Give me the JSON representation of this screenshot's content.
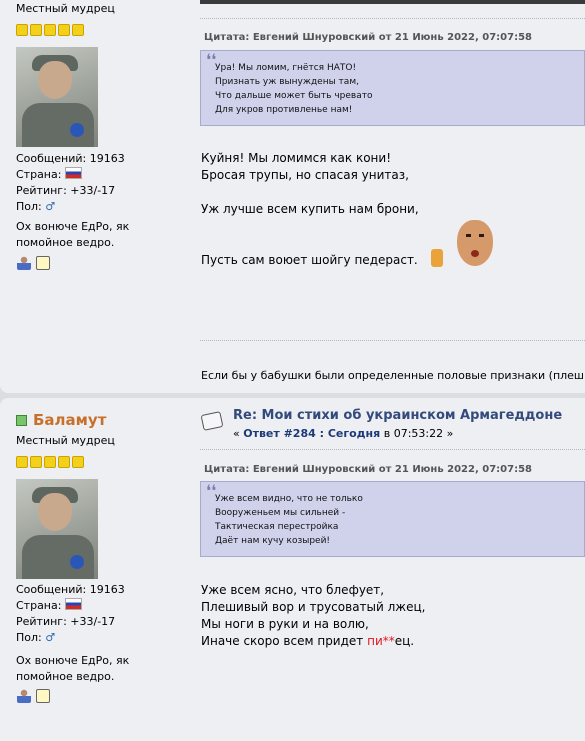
{
  "post1": {
    "rank": "Местный мудрец",
    "stats": {
      "messages_label": "Сообщений:",
      "messages_value": "19163",
      "country_label": "Страна:",
      "rating_label": "Рейтинг:",
      "rating_value": "+33/-17",
      "gender_label": "Пол:",
      "gender_value": "♂"
    },
    "signature": [
      "Ох вонюче ЕдРо, як",
      "помойное ведро."
    ],
    "quote": {
      "header": "Цитата: Евгений Шнуровский от 21 Июнь 2022, 07:07:58",
      "lines": [
        "Ура! Мы ломим, гнётся НАТО!",
        "Признать уж вынуждены там,",
        "Что дальше может быть чревато",
        "Для укров противленье нам!"
      ]
    },
    "text": [
      "Куйня! Мы ломимся как кони!",
      "Бросая трупы, но спасая унитаз,",
      "Уж лучше всем купить нам брони,",
      "Пусть сам воюет шойгу педераст."
    ],
    "signature_text": "Если бы у бабушки были определенные половые признаки (плешь) , т"
  },
  "post2": {
    "username": "Баламут",
    "rank": "Местный мудрец",
    "title": "Re: Мои стихи об украинском Армагеддоне",
    "subtitle_prefix": "« ",
    "reply_label": "Ответ #284 : Сегодня",
    "time_prefix": " в ",
    "time": "07:53:22",
    "subtitle_suffix": " »",
    "stats": {
      "messages_label": "Сообщений:",
      "messages_value": "19163",
      "country_label": "Страна:",
      "rating_label": "Рейтинг:",
      "rating_value": "+33/-17",
      "gender_label": "Пол:",
      "gender_value": "♂"
    },
    "signature": [
      "Ох вонюче ЕдРо, як",
      "помойное ведро."
    ],
    "quote": {
      "header": "Цитата: Евгений Шнуровский от 21 Июнь 2022, 07:07:58",
      "lines": [
        "Уже всем видно, что не только",
        "Вооруженьем мы сильней -",
        "Тактическая перестройка",
        "Даёт нам кучу козырей!"
      ]
    },
    "text": [
      "Уже всем ясно, что блефует,",
      "Плешивый вор и трусоватый лжец,",
      "Мы ноги в руки и на волю,"
    ],
    "last_line_start": "Иначе скоро всем придет ",
    "last_line_red1": "пи",
    "last_line_red2": "**",
    "last_line_end": "ец."
  },
  "colors": {
    "username": "#c8702a",
    "title": "#334a7d",
    "quote_bg": "#d0d2ec",
    "censor": "#e0151f"
  },
  "icons": {
    "online": "green-square-icon",
    "profile": "profile-icon",
    "pm": "message-icon",
    "reply": "post-icon"
  }
}
